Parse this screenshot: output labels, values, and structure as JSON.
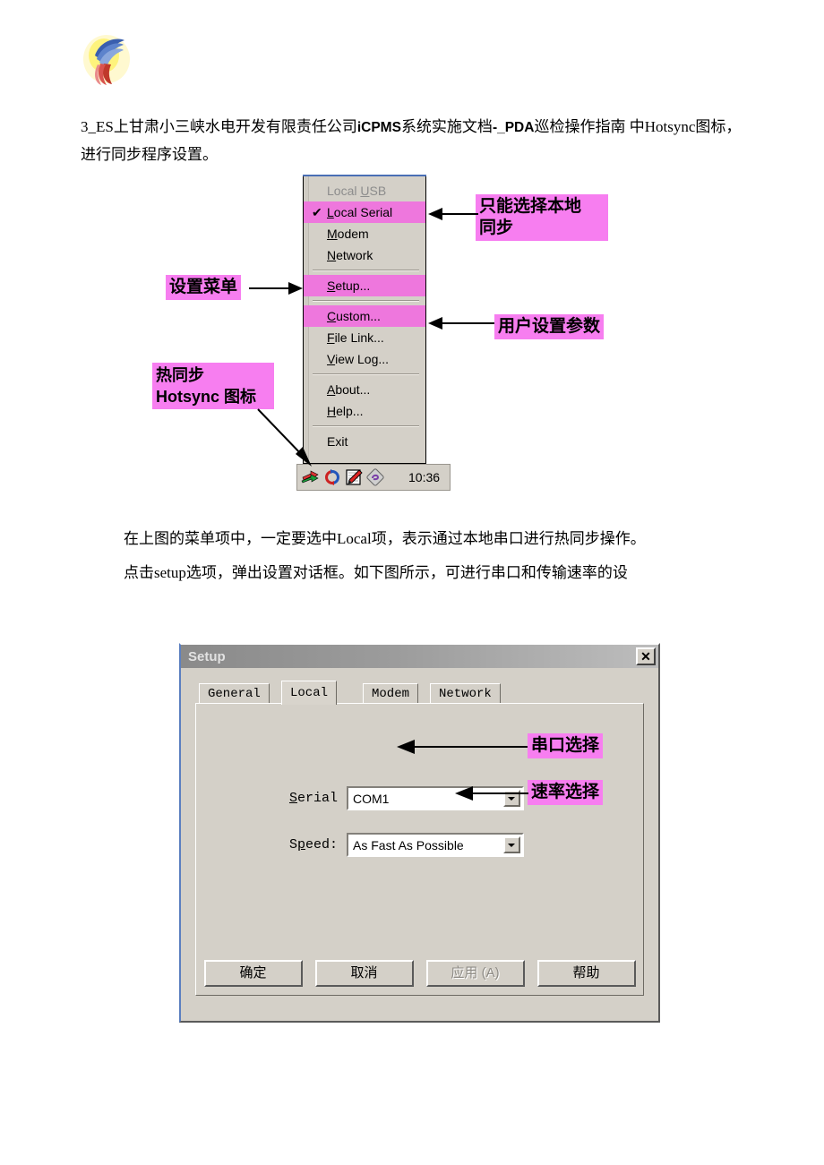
{
  "document": {
    "logo_alt": "company-swirl-logo",
    "intro_paragraph_parts": {
      "a": "3_ES上甘肃小三峡水电开发有限责任公司",
      "b": "iCPMS",
      "c": "系统实施文档",
      "d": "-_PDA",
      "e": "巡检操作指南  中Hotsync图标，进行同步程序设置。"
    },
    "middle_paragraph_line1": "在上图的菜单项中，一定要选中Local项，表示通过本地串口进行热同步操作。",
    "middle_paragraph_line2": "点击setup选项，弹出设置对话框。如下图所示，可进行串口和传输速率的设"
  },
  "context_menu": {
    "items": [
      {
        "label": "Local USB",
        "mnemonic": "U",
        "state": "disabled",
        "checked": false,
        "highlight": false
      },
      {
        "label": "Local Serial",
        "mnemonic": "L",
        "state": "enabled",
        "checked": true,
        "highlight": true
      },
      {
        "label": "Modem",
        "mnemonic": "M",
        "state": "enabled",
        "checked": false,
        "highlight": false
      },
      {
        "label": "Network",
        "mnemonic": "N",
        "state": "enabled",
        "checked": false,
        "highlight": false
      },
      {
        "label": "Setup...",
        "mnemonic": "S",
        "state": "enabled",
        "checked": false,
        "highlight": true
      },
      {
        "label": "Custom...",
        "mnemonic": "C",
        "state": "enabled",
        "checked": false,
        "highlight": true
      },
      {
        "label": "File Link...",
        "mnemonic": "F",
        "state": "enabled",
        "checked": false,
        "highlight": false
      },
      {
        "label": "View Log...",
        "mnemonic": "V",
        "state": "enabled",
        "checked": false,
        "highlight": false
      },
      {
        "label": "About...",
        "mnemonic": "A",
        "state": "enabled",
        "checked": false,
        "highlight": false
      },
      {
        "label": "Help...",
        "mnemonic": "H",
        "state": "enabled",
        "checked": false,
        "highlight": false
      },
      {
        "label": "Exit",
        "mnemonic": "",
        "state": "enabled",
        "checked": false,
        "highlight": false
      }
    ],
    "check_glyph": "✔"
  },
  "system_tray": {
    "icons": [
      "green-arrow-icon",
      "hotsync-sync-icon",
      "notepad-pencil-icon",
      "diamond-purple-icon"
    ],
    "clock": "10:36"
  },
  "annotations": {
    "local_serial": "只能选择本地\n同步",
    "setup_menu": "设置菜单",
    "custom_params": "用户设置参数",
    "hotsync_icon": "热同步\nHotsync 图标",
    "serial_port": "串口选择",
    "speed_select": "速率选择",
    "highlight_color": "#f77ef0"
  },
  "setup_dialog": {
    "title": "Setup",
    "close_label": "✕",
    "tabs": [
      {
        "label": "General",
        "active": false
      },
      {
        "label": "Local",
        "active": true
      },
      {
        "label": "Modem",
        "active": false
      },
      {
        "label": "Network",
        "active": false
      }
    ],
    "fields": {
      "serial_label": "Serial",
      "serial_value": "COM1",
      "speed_label": "Speed:",
      "speed_value": "As Fast As Possible"
    },
    "buttons": [
      {
        "label": "确定",
        "disabled": false
      },
      {
        "label": "取消",
        "disabled": false
      },
      {
        "label": "应用 (A)",
        "disabled": true
      },
      {
        "label": "帮助",
        "disabled": false
      }
    ]
  }
}
